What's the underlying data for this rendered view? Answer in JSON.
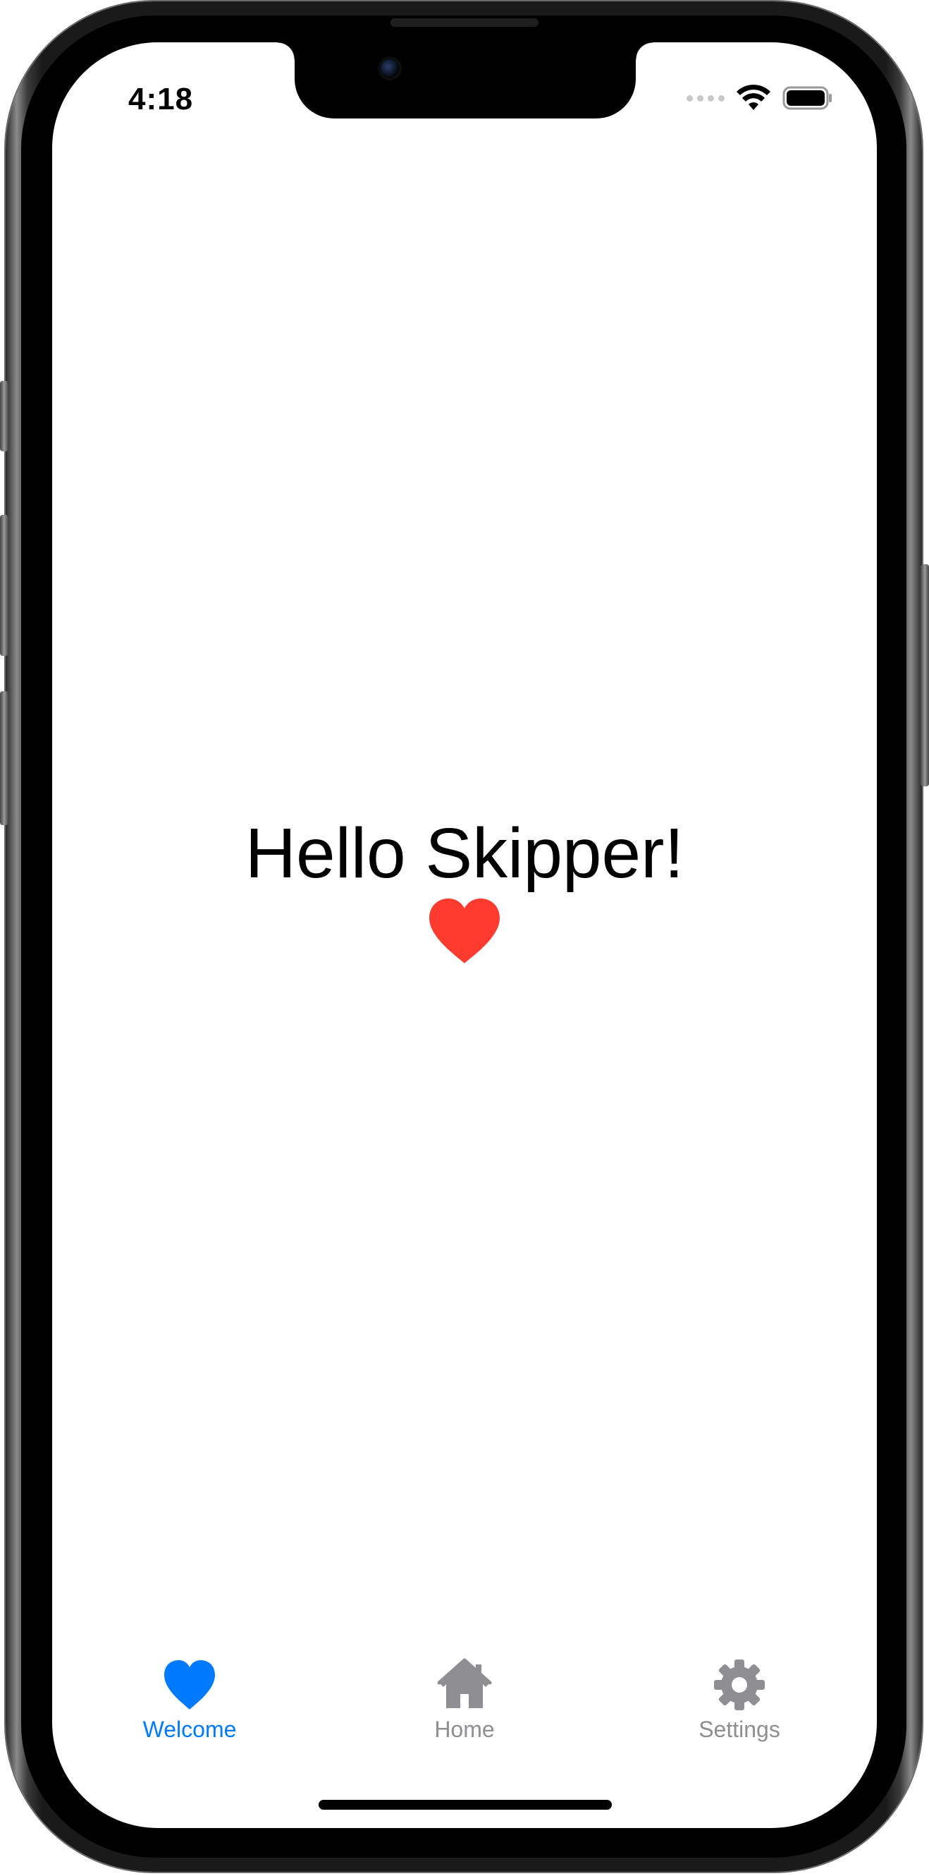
{
  "status_bar": {
    "time": "4:18"
  },
  "main": {
    "greeting": "Hello Skipper!",
    "greeting_icon": "heart-fill-icon",
    "heart_color": "#ff3b30"
  },
  "tabbar": {
    "active_color": "#007aff",
    "inactive_color": "#8e8e93",
    "tabs": [
      {
        "label": "Welcome",
        "icon": "heart-fill-icon",
        "selected": true
      },
      {
        "label": "Home",
        "icon": "house-fill-icon",
        "selected": false
      },
      {
        "label": "Settings",
        "icon": "gear-fill-icon",
        "selected": false
      }
    ]
  }
}
